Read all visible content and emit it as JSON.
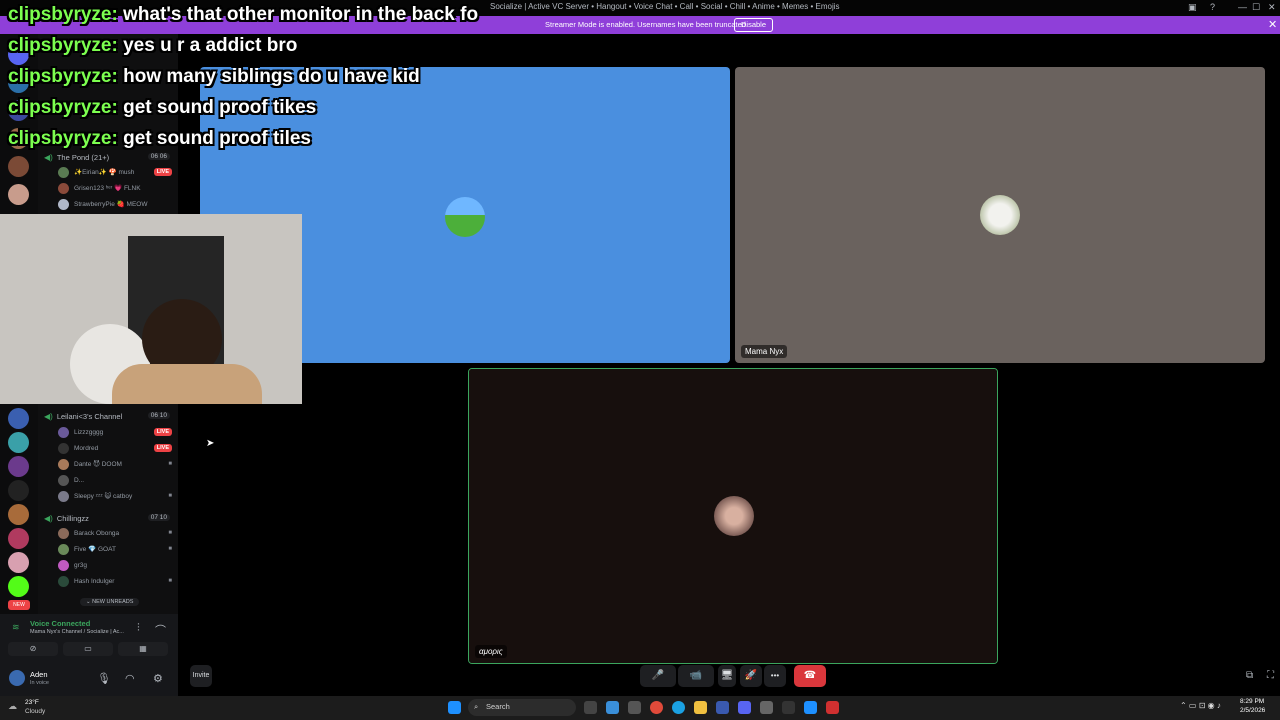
{
  "window": {
    "title": "Socialize | Active VC Server • Hangout • Voice Chat • Call • Social • Chill • Anime • Memes • Emojis",
    "controls": [
      "—",
      "☐",
      "✕"
    ]
  },
  "streamer_banner": {
    "message": "Streamer Mode is enabled. Usernames have been truncated.",
    "button": "Disable",
    "close": "✕"
  },
  "chat_overlay": [
    {
      "name": "clipsbyryze:",
      "text": "what's that other monitor in the back fo"
    },
    {
      "name": "clipsbyryze:",
      "text": "yes u r a addict bro"
    },
    {
      "name": "clipsbyryze:",
      "text": "how many siblings do u have kid"
    },
    {
      "name": "clipsbyryze:",
      "text": "get sound proof tikes"
    },
    {
      "name": "clipsbyryze:",
      "text": "get sound proof tiles"
    }
  ],
  "channels": {
    "pond": {
      "name": "The Pond (21+)",
      "count": "06 06",
      "users": [
        {
          "name": "✨Eirian✨ 🍄 mush",
          "live": "LIVE"
        },
        {
          "name": "Grisen123 ʰᵉʳ 💗 FLNK"
        },
        {
          "name": "StrawberryPie 🍓 MEOW"
        }
      ]
    },
    "leilani": {
      "name": "Leilani<3's Channel",
      "count": "06 10",
      "users": [
        {
          "name": "Lizzzgggg",
          "live": "LIVE"
        },
        {
          "name": "Mordred",
          "live": "LIVE"
        },
        {
          "name": "Dante 😈 DOOM"
        },
        {
          "name": "D..."
        },
        {
          "name": "Sleepy ᶻᶻᶻ 😺 catboy"
        }
      ]
    },
    "chilling": {
      "name": "Chillingzz",
      "count": "07 10",
      "users": [
        {
          "name": "Barack Obonga"
        },
        {
          "name": "Five 💎 GOAT"
        },
        {
          "name": "gr3g"
        },
        {
          "name": "Hash Indulger"
        }
      ]
    },
    "new_unreads": "⌄ NEW UNREADS"
  },
  "voice_panel": {
    "status": "Voice Connected",
    "channel": "Mama Nyx's Channel / Socialize | Ac...",
    "user": "Aden",
    "user_status": "In voice"
  },
  "tiles": [
    {
      "name": "",
      "bg": "#4a8fdf"
    },
    {
      "name": "Mama Nyx",
      "bg": "#6a625e"
    },
    {
      "name": "αμορις",
      "bg": "#170f0d"
    }
  ],
  "controls": {
    "invite": "Invite",
    "mic": "🎤",
    "video": "📹",
    "share": "🖥",
    "activity": "🚀",
    "more": "•••",
    "leave": "☎"
  },
  "taskbar": {
    "weather_temp": "23°F",
    "weather_desc": "Cloudy",
    "search": "Search",
    "time": "8:29 PM",
    "date": "2/5/2026"
  }
}
